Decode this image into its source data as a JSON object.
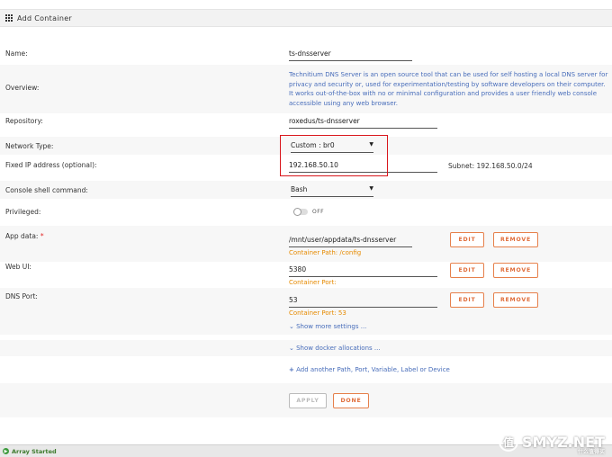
{
  "header": {
    "title": "Add Container"
  },
  "form": {
    "name": {
      "label": "Name:",
      "value": "ts-dnsserver"
    },
    "overview": {
      "label": "Overview:",
      "text": "Technitium DNS Server is an open source tool that can be used for self hosting a local DNS server for privacy and security or, used for experimentation/testing by software developers on their computer. It works out-of-the-box with no or minimal configuration and provides a user friendly web console accessible using any web browser."
    },
    "repository": {
      "label": "Repository:",
      "value": "roxedus/ts-dnsserver"
    },
    "network_type": {
      "label": "Network Type:",
      "value": "Custom : br0"
    },
    "fixed_ip": {
      "label": "Fixed IP address (optional):",
      "value": "192.168.50.10",
      "subnet": "Subnet: 192.168.50.0/24"
    },
    "console_shell": {
      "label": "Console shell command:",
      "value": "Bash"
    },
    "privileged": {
      "label": "Privileged:",
      "state": "OFF"
    },
    "app_data": {
      "label": "App data:",
      "required_mark": "*",
      "value": "/mnt/user/appdata/ts-dnsserver",
      "hint": "Container Path: /config"
    },
    "web_ui": {
      "label": "Web UI:",
      "value": "5380",
      "hint": "Container Port:"
    },
    "dns_port": {
      "label": "DNS Port:",
      "value": "53",
      "hint": "Container Port: 53"
    }
  },
  "buttons": {
    "edit": "EDIT",
    "remove": "REMOVE",
    "apply": "APPLY",
    "done": "DONE"
  },
  "links": {
    "more_settings": "Show more settings ...",
    "docker_allocations": "Show docker allocations ...",
    "add_another": "Add another Path, Port, Variable, Label or Device"
  },
  "status": {
    "text": "Array Started"
  },
  "watermark": {
    "logo": "值",
    "text": "SMYZ.NET",
    "sub": "什么值得买"
  },
  "colors": {
    "accent": "#e6804b",
    "link": "#486dba",
    "hint": "#e68a00",
    "highlight": "#d9161c",
    "status": "#3c9a3c"
  }
}
